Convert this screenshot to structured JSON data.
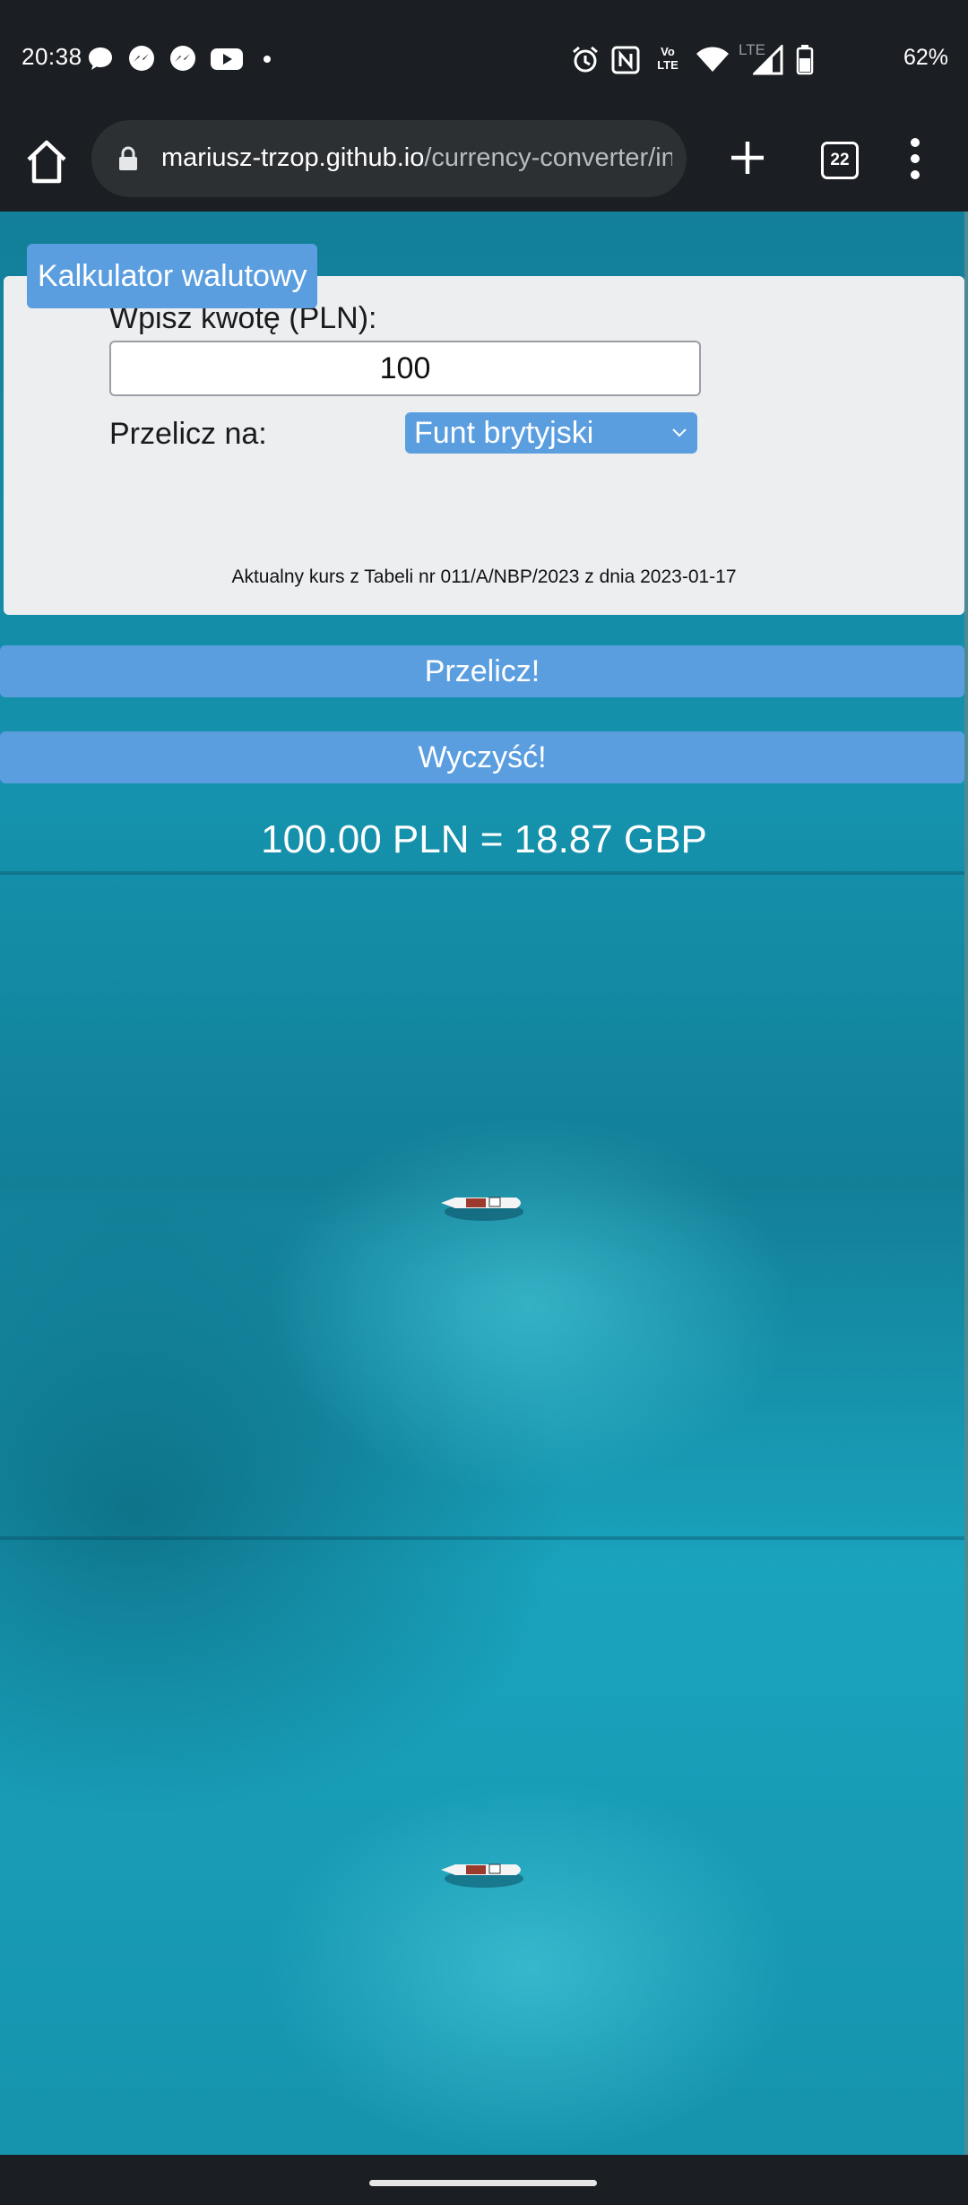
{
  "status_bar": {
    "time": "20:38",
    "left_icons": [
      "threads-icon",
      "messenger-icon",
      "messenger-icon",
      "youtube-icon",
      "dot-icon"
    ],
    "right_icons": [
      "alarm-icon",
      "nfc-icon",
      "volte-icon",
      "wifi-icon",
      "lte-signal-icon",
      "battery-icon"
    ],
    "volte_label": "Vo LTE",
    "lte_label": "LTE",
    "battery": "62%"
  },
  "browser": {
    "url_host": "mariusz-trzop.github.io",
    "url_path": "/currency-converter/ind",
    "tab_count": "22"
  },
  "calculator": {
    "title": "Kalkulator walutowy",
    "amount_label": "Wpisz kwotę (PLN):",
    "amount_value": "100",
    "convert_label": "Przelicz na:",
    "selected_currency": "Funt brytyjski",
    "rate_note": "Aktualny kurs z Tabeli nr 011/A/NBP/2023 z dnia 2023-01-17",
    "convert_button": "Przelicz!",
    "clear_button": "Wyczyść!",
    "result": "100.00 PLN = 18.87 GBP"
  },
  "colors": {
    "accent": "#5b9ee0",
    "card": "#eceef0",
    "ocean": "#1593ae",
    "chrome": "#1b1e22"
  }
}
